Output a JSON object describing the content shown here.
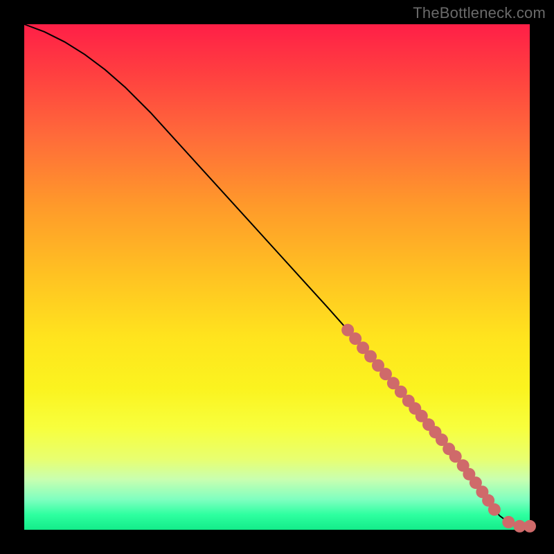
{
  "watermark": "TheBottleneck.com",
  "colors": {
    "background": "#000000",
    "point": "#cf6a6a",
    "curve": "#000000"
  },
  "chart_data": {
    "type": "line",
    "title": "",
    "xlabel": "",
    "ylabel": "",
    "xlim": [
      0,
      100
    ],
    "ylim": [
      0,
      100
    ],
    "grid": false,
    "legend": false,
    "series": [
      {
        "name": "curve",
        "x": [
          0,
          4,
          8,
          12,
          16,
          20,
          25,
          30,
          35,
          40,
          45,
          50,
          55,
          60,
          64,
          67,
          70,
          73,
          76,
          79,
          82,
          84,
          86,
          88,
          90,
          92,
          94,
          96,
          98,
          100
        ],
        "y": [
          100,
          98.5,
          96.5,
          94,
          91,
          87.5,
          82.5,
          77,
          71.5,
          66,
          60.5,
          55,
          49.5,
          44,
          39.5,
          36,
          32.5,
          29,
          25.5,
          22,
          18.5,
          16,
          13.5,
          11,
          8.2,
          5.5,
          2.8,
          1.3,
          0.7,
          0.7
        ]
      }
    ],
    "points": [
      {
        "x": 64.0,
        "y": 39.5
      },
      {
        "x": 65.5,
        "y": 37.8
      },
      {
        "x": 67.0,
        "y": 36.0
      },
      {
        "x": 68.5,
        "y": 34.3
      },
      {
        "x": 70.0,
        "y": 32.5
      },
      {
        "x": 71.5,
        "y": 30.8
      },
      {
        "x": 73.0,
        "y": 29.0
      },
      {
        "x": 74.5,
        "y": 27.3
      },
      {
        "x": 76.0,
        "y": 25.5
      },
      {
        "x": 77.3,
        "y": 24.0
      },
      {
        "x": 78.6,
        "y": 22.5
      },
      {
        "x": 80.0,
        "y": 20.8
      },
      {
        "x": 81.3,
        "y": 19.3
      },
      {
        "x": 82.6,
        "y": 17.8
      },
      {
        "x": 84.0,
        "y": 16.0
      },
      {
        "x": 85.3,
        "y": 14.5
      },
      {
        "x": 86.8,
        "y": 12.7
      },
      {
        "x": 88.0,
        "y": 11.0
      },
      {
        "x": 89.3,
        "y": 9.3
      },
      {
        "x": 90.6,
        "y": 7.5
      },
      {
        "x": 91.8,
        "y": 5.8
      },
      {
        "x": 93.0,
        "y": 4.0
      },
      {
        "x": 95.8,
        "y": 1.5
      },
      {
        "x": 98.0,
        "y": 0.7
      },
      {
        "x": 100.0,
        "y": 0.7
      }
    ]
  }
}
